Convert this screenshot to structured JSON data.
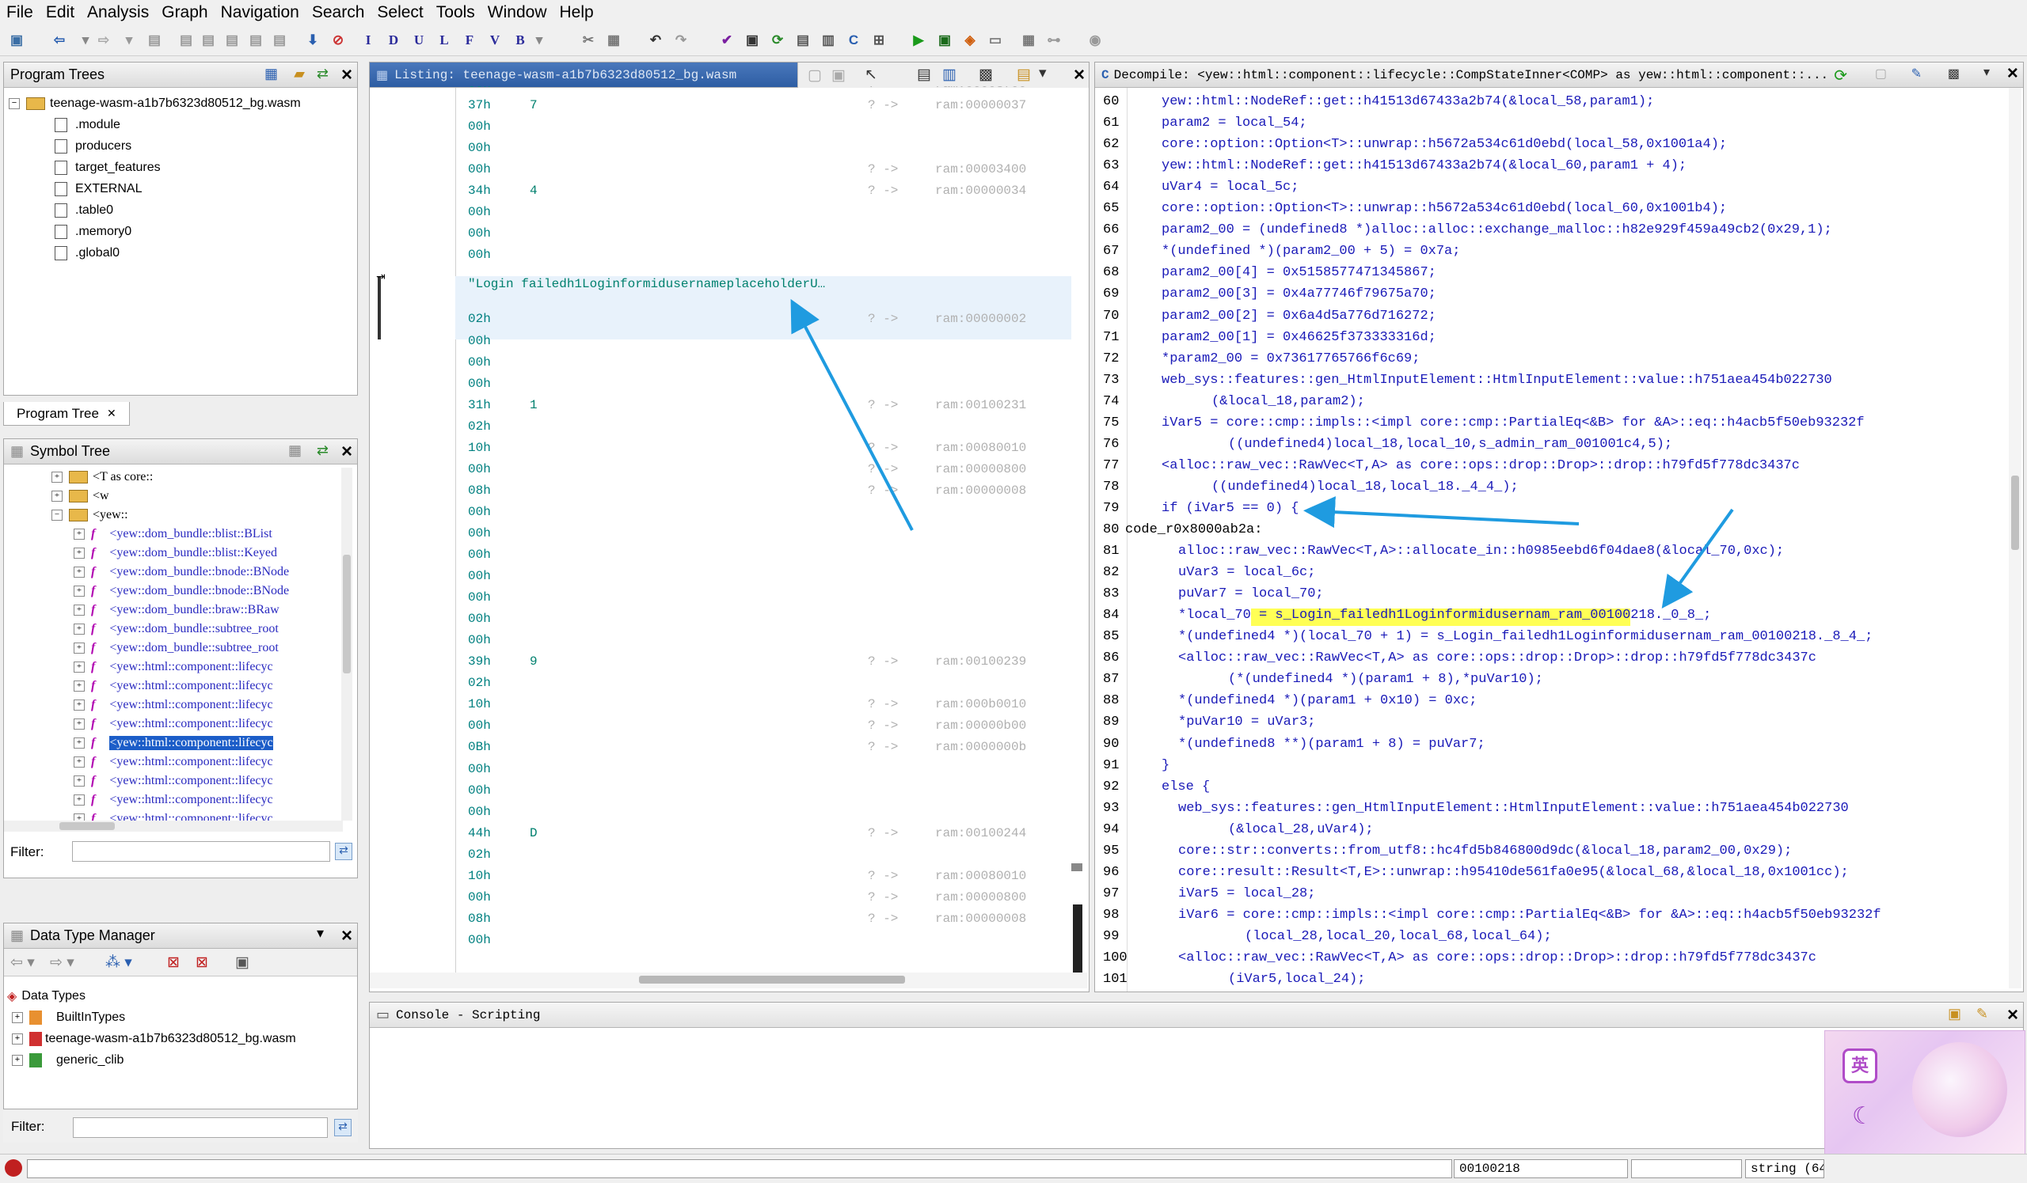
{
  "menu": [
    "File",
    "Edit",
    "Analysis",
    "Graph",
    "Navigation",
    "Search",
    "Select",
    "Tools",
    "Window",
    "Help"
  ],
  "program_trees": {
    "title": "Program Trees",
    "root": "teenage-wasm-a1b7b6323d80512_bg.wasm",
    "items": [
      ".module",
      "producers",
      "target_features",
      "EXTERNAL",
      ".table0",
      ".memory0",
      ".global0"
    ],
    "tab": "Program Tree"
  },
  "symbol_tree": {
    "title": "Symbol Tree",
    "folders": [
      "<T  as  core::",
      "<w",
      "<yew::"
    ],
    "items": [
      "<yew::dom_bundle::blist::BList",
      "<yew::dom_bundle::blist::Keyed",
      "<yew::dom_bundle::bnode::BNode",
      "<yew::dom_bundle::bnode::BNode",
      "<yew::dom_bundle::braw::BRaw",
      "<yew::dom_bundle::subtree_root",
      "<yew::dom_bundle::subtree_root",
      "<yew::html::component::lifecyc",
      "<yew::html::component::lifecyc",
      "<yew::html::component::lifecyc",
      "<yew::html::component::lifecyc",
      "<yew::html::component::lifecyc",
      "<yew::html::component::lifecyc",
      "<yew::html::component::lifecyc",
      "<yew::html::component::lifecyc",
      "<yew::html::component::lifecyc",
      "<yew::html::component::lifecyc"
    ],
    "selected_index": 11,
    "filter_label": "Filter:"
  },
  "data_type_manager": {
    "title": "Data Type Manager",
    "root": "Data Types",
    "items": [
      "BuiltInTypes",
      "teenage-wasm-a1b7b6323d80512_bg.wasm",
      "generic_clib"
    ],
    "filter_label": "Filter:"
  },
  "listing": {
    "title": "Listing:  teenage-wasm-a1b7b6323d80512_bg.wasm",
    "rows": [
      {
        "hex": "00h",
        "ch": "",
        "xr": "?  ->",
        "ram": "ram:00003700"
      },
      {
        "hex": "37h",
        "ch": "7",
        "xr": "?  ->",
        "ram": "ram:00000037"
      },
      {
        "hex": "00h",
        "ch": "",
        "xr": "",
        "ram": ""
      },
      {
        "hex": "00h",
        "ch": "",
        "xr": "",
        "ram": ""
      },
      {
        "hex": "00h",
        "ch": "",
        "xr": "?  ->",
        "ram": "ram:00003400"
      },
      {
        "hex": "34h",
        "ch": "4",
        "xr": "?  ->",
        "ram": "ram:00000034"
      },
      {
        "hex": "00h",
        "ch": "",
        "xr": "",
        "ram": ""
      },
      {
        "hex": "00h",
        "ch": "",
        "xr": "",
        "ram": ""
      },
      {
        "hex": "00h",
        "ch": "",
        "xr": "",
        "ram": ""
      },
      {
        "hex": "02h",
        "ch": "",
        "xr": "?  ->",
        "ram": "ram:00000002"
      },
      {
        "hex": "00h",
        "ch": "",
        "xr": "",
        "ram": ""
      },
      {
        "hex": "00h",
        "ch": "",
        "xr": "",
        "ram": ""
      },
      {
        "hex": "00h",
        "ch": "",
        "xr": "",
        "ram": ""
      },
      {
        "hex": "31h",
        "ch": "1",
        "xr": "?  ->",
        "ram": "ram:00100231"
      },
      {
        "hex": "02h",
        "ch": "",
        "xr": "",
        "ram": ""
      },
      {
        "hex": "10h",
        "ch": "",
        "xr": "?  ->",
        "ram": "ram:00080010"
      },
      {
        "hex": "00h",
        "ch": "",
        "xr": "?  ->",
        "ram": "ram:00000800"
      },
      {
        "hex": "08h",
        "ch": "",
        "xr": "?  ->",
        "ram": "ram:00000008"
      },
      {
        "hex": "00h",
        "ch": "",
        "xr": "",
        "ram": ""
      },
      {
        "hex": "00h",
        "ch": "",
        "xr": "",
        "ram": ""
      },
      {
        "hex": "00h",
        "ch": "",
        "xr": "",
        "ram": ""
      },
      {
        "hex": "00h",
        "ch": "",
        "xr": "",
        "ram": ""
      },
      {
        "hex": "00h",
        "ch": "",
        "xr": "",
        "ram": ""
      },
      {
        "hex": "00h",
        "ch": "",
        "xr": "",
        "ram": ""
      },
      {
        "hex": "00h",
        "ch": "",
        "xr": "",
        "ram": ""
      },
      {
        "hex": "39h",
        "ch": "9",
        "xr": "?  ->",
        "ram": "ram:00100239"
      },
      {
        "hex": "02h",
        "ch": "",
        "xr": "",
        "ram": ""
      },
      {
        "hex": "10h",
        "ch": "",
        "xr": "?  ->",
        "ram": "ram:000b0010"
      },
      {
        "hex": "00h",
        "ch": "",
        "xr": "?  ->",
        "ram": "ram:00000b00"
      },
      {
        "hex": "0Bh",
        "ch": "",
        "xr": "?  ->",
        "ram": "ram:0000000b"
      },
      {
        "hex": "00h",
        "ch": "",
        "xr": "",
        "ram": ""
      },
      {
        "hex": "00h",
        "ch": "",
        "xr": "",
        "ram": ""
      },
      {
        "hex": "00h",
        "ch": "",
        "xr": "",
        "ram": ""
      },
      {
        "hex": "44h",
        "ch": "D",
        "xr": "?  ->",
        "ram": "ram:00100244"
      },
      {
        "hex": "02h",
        "ch": "",
        "xr": "",
        "ram": ""
      },
      {
        "hex": "10h",
        "ch": "",
        "xr": "?  ->",
        "ram": "ram:00080010"
      },
      {
        "hex": "00h",
        "ch": "",
        "xr": "?  ->",
        "ram": "ram:00000800"
      },
      {
        "hex": "08h",
        "ch": "",
        "xr": "?  ->",
        "ram": "ram:00000008"
      },
      {
        "hex": "00h",
        "ch": "",
        "xr": "",
        "ram": ""
      }
    ],
    "string_row": "\"Login failedh1LoginformidusernameplaceholderU…"
  },
  "decompile": {
    "title": "Decompile: <yew::html::component::lifecycle::CompStateInner<COMP>  as  yew::html::component::...",
    "lines": [
      {
        "n": "60",
        "c": "yew::html::NodeRef::get::h41513d67433a2b74(&local_58,param1);",
        "i": 0
      },
      {
        "n": "61",
        "c": "param2 = local_54;",
        "i": 0
      },
      {
        "n": "62",
        "c": "core::option::Option<T>::unwrap::h5672a534c61d0ebd(local_58,0x1001a4);",
        "i": 0
      },
      {
        "n": "63",
        "c": "yew::html::NodeRef::get::h41513d67433a2b74(&local_60,param1 + 4);",
        "i": 0
      },
      {
        "n": "64",
        "c": "uVar4 = local_5c;",
        "i": 0
      },
      {
        "n": "65",
        "c": "core::option::Option<T>::unwrap::h5672a534c61d0ebd(local_60,0x1001b4);",
        "i": 0
      },
      {
        "n": "66",
        "c": "param2_00 = (undefined8 *)alloc::alloc::exchange_malloc::h82e929f459a49cb2(0x29,1);",
        "i": 0
      },
      {
        "n": "67",
        "c": "*(undefined *)(param2_00 + 5) = 0x7a;",
        "i": 0
      },
      {
        "n": "68",
        "c": "param2_00[4] = 0x5158577471345867;",
        "i": 0
      },
      {
        "n": "69",
        "c": "param2_00[3] = 0x4a77746f79675a70;",
        "i": 0
      },
      {
        "n": "70",
        "c": "param2_00[2] = 0x6a4d5a776d716272;",
        "i": 0
      },
      {
        "n": "71",
        "c": "param2_00[1] = 0x46625f373333316d;",
        "i": 0
      },
      {
        "n": "72",
        "c": "*param2_00 = 0x73617765766f6c69;",
        "i": 0
      },
      {
        "n": "73",
        "c": "web_sys::features::gen_HtmlInputElement::HtmlInputElement::value::h751aea454b022730",
        "i": 0
      },
      {
        "n": "74",
        "c": "(&local_18,param2);",
        "i": 3
      },
      {
        "n": "75",
        "c": "iVar5 = core::cmp::impls::<impl core::cmp::PartialEq<&B> for &A>::eq::h4acb5f50eb93232f",
        "i": 0
      },
      {
        "n": "76",
        "c": "((undefined4)local_18,local_10,s_admin_ram_001001c4,5);",
        "i": 4
      },
      {
        "n": "77",
        "c": "<alloc::raw_vec::RawVec<T,A> as core::ops::drop::Drop>::drop::h79fd5f778dc3437c",
        "i": 0
      },
      {
        "n": "78",
        "c": "((undefined4)local_18,local_18._4_4_);",
        "i": 3
      },
      {
        "n": "79",
        "c": "if (iVar5 == 0) {",
        "i": 0
      },
      {
        "n": "80",
        "c": "code_r0x8000ab2a:",
        "i": -1
      },
      {
        "n": "81",
        "c": "alloc::raw_vec::RawVec<T,A>::allocate_in::h0985eebd6f04dae8(&local_70,0xc);",
        "i": 1
      },
      {
        "n": "82",
        "c": "uVar3 = local_6c;",
        "i": 1
      },
      {
        "n": "83",
        "c": "puVar7 = local_70;",
        "i": 1
      },
      {
        "n": "84",
        "c": "*local_70 = s_Login_failedh1Loginformidusernam_ram_00100218._0_8_;",
        "i": 1
      },
      {
        "n": "85",
        "c": "*(undefined4 *)(local_70 + 1) = s_Login_failedh1Loginformidusernam_ram_00100218._8_4_;",
        "i": 1
      },
      {
        "n": "86",
        "c": "<alloc::raw_vec::RawVec<T,A> as core::ops::drop::Drop>::drop::h79fd5f778dc3437c",
        "i": 1
      },
      {
        "n": "87",
        "c": "(*(undefined4 *)(param1 + 8),*puVar10);",
        "i": 4
      },
      {
        "n": "88",
        "c": "*(undefined4 *)(param1 + 0x10) = 0xc;",
        "i": 1
      },
      {
        "n": "89",
        "c": "*puVar10 = uVar3;",
        "i": 1
      },
      {
        "n": "90",
        "c": "*(undefined8 **)(param1 + 8) = puVar7;",
        "i": 1
      },
      {
        "n": "91",
        "c": "}",
        "i": 0
      },
      {
        "n": "92",
        "c": "else {",
        "i": 0
      },
      {
        "n": "93",
        "c": "web_sys::features::gen_HtmlInputElement::HtmlInputElement::value::h751aea454b022730",
        "i": 1
      },
      {
        "n": "94",
        "c": "(&local_28,uVar4);",
        "i": 4
      },
      {
        "n": "95",
        "c": "core::str::converts::from_utf8::hc4fd5b846800d9dc(&local_18,param2_00,0x29);",
        "i": 1
      },
      {
        "n": "96",
        "c": "core::result::Result<T,E>::unwrap::h95410de561fa0e95(&local_68,&local_18,0x1001cc);",
        "i": 1
      },
      {
        "n": "97",
        "c": "iVar5 = local_28;",
        "i": 1
      },
      {
        "n": "98",
        "c": "iVar6 = core::cmp::impls::<impl core::cmp::PartialEq<&B> for &A>::eq::h4acb5f50eb93232f",
        "i": 1
      },
      {
        "n": "99",
        "c": "(local_28,local_20,local_68,local_64);",
        "i": 5
      },
      {
        "n": "100",
        "c": "<alloc::raw_vec::RawVec<T,A> as core::ops::drop::Drop>::drop::h79fd5f778dc3437c",
        "i": 1
      },
      {
        "n": "101",
        "c": "(iVar5,local_24);",
        "i": 4
      }
    ],
    "highlight_text": "s_Login_failedh1Loginformidusernam_ram_00100218"
  },
  "console": {
    "title": "Console - Scripting"
  },
  "status": {
    "address": "00100218",
    "type": "string  (64)"
  }
}
